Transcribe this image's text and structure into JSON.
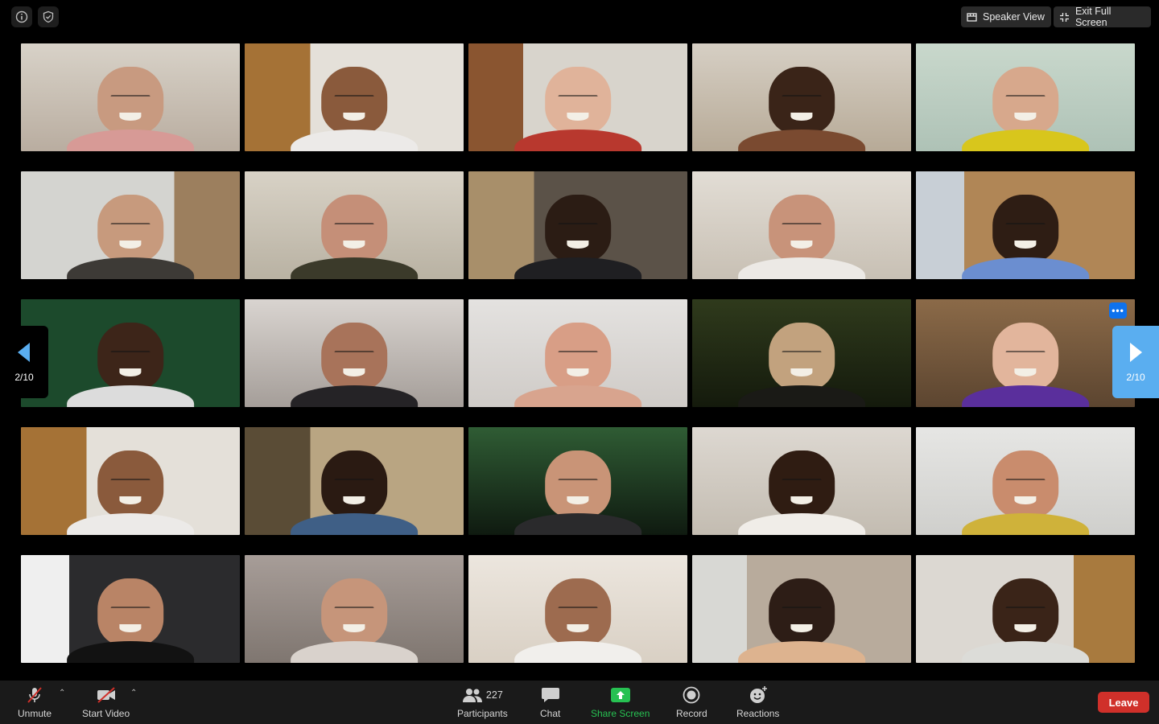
{
  "top_bar": {
    "speaker_view_label": "Speaker View",
    "exit_full_screen_label": "Exit Full Screen"
  },
  "paging": {
    "left_label": "2/10",
    "right_label": "2/10"
  },
  "toolbar": {
    "unmute_label": "Unmute",
    "start_video_label": "Start Video",
    "participants_label": "Participants",
    "participants_count": "227",
    "chat_label": "Chat",
    "share_screen_label": "Share Screen",
    "record_label": "Record",
    "reactions_label": "Reactions",
    "leave_label": "Leave"
  },
  "colors": {
    "share_green": "#27c152",
    "leave_red": "#d0302a",
    "page_blue": "#5aaef0",
    "more_blue": "#0e72ed"
  }
}
